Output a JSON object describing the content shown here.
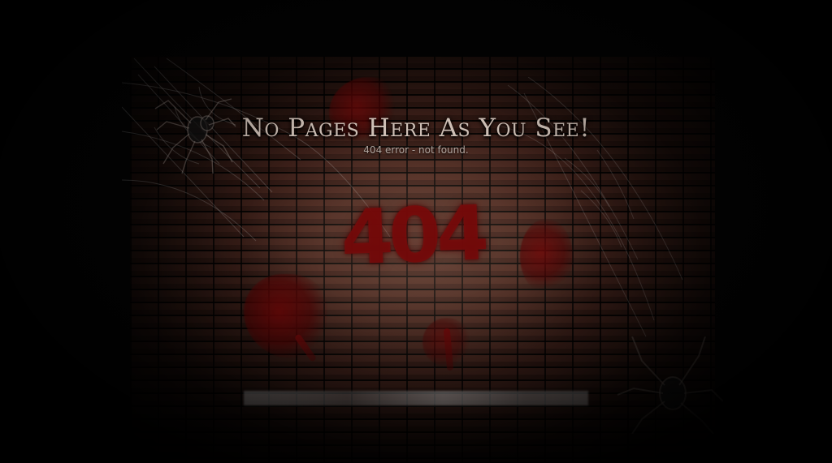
{
  "page": {
    "title": "No Pages Here As You See!",
    "subtitle": "404 error - not found.",
    "error_code": "404"
  },
  "footer": {
    "links": [
      "",
      "",
      "",
      "",
      ""
    ]
  },
  "icons": {
    "spider_left": "spider-icon",
    "spider_right": "spider-icon",
    "web_left": "spider-web-icon",
    "web_right": "spider-web-icon"
  },
  "colors": {
    "background": "#030303",
    "brick": "#3a1f17",
    "blood": "#7d0a0a",
    "title": "#d8c9bf",
    "subtitle": "#b7aaa3"
  }
}
